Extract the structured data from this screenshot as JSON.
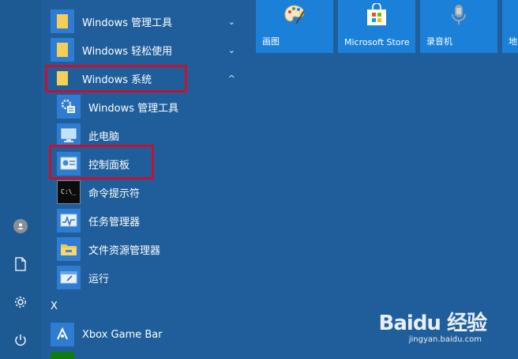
{
  "app_list": {
    "folders": [
      {
        "label": "Windows 管理工具",
        "chevron": "⌄"
      },
      {
        "label": "Windows 轻松使用",
        "chevron": "⌄"
      },
      {
        "label": "Windows 系统",
        "chevron": "^"
      }
    ],
    "sub_items": [
      {
        "label": "Windows 管理工具",
        "icon": "admin-tools-icon"
      },
      {
        "label": "此电脑",
        "icon": "this-pc-icon"
      },
      {
        "label": "控制面板",
        "icon": "control-panel-icon"
      },
      {
        "label": "命令提示符",
        "icon": "cmd-icon"
      },
      {
        "label": "任务管理器",
        "icon": "task-manager-icon"
      },
      {
        "label": "文件资源管理器",
        "icon": "file-explorer-icon"
      },
      {
        "label": "运行",
        "icon": "run-icon"
      }
    ],
    "section_letter": "X",
    "xbox": {
      "label": "Xbox Game Bar",
      "icon": "xbox-icon"
    }
  },
  "tiles": [
    {
      "label": "画图",
      "icon": "paint-icon"
    },
    {
      "label": "Microsoft Store",
      "icon": "store-icon"
    },
    {
      "label": "录音机",
      "icon": "microphone-icon"
    },
    {
      "label": "地",
      "icon": "maps-icon"
    }
  ],
  "rail": [
    {
      "icon": "user-icon"
    },
    {
      "icon": "document-icon"
    },
    {
      "icon": "settings-icon"
    },
    {
      "icon": "power-icon"
    }
  ],
  "watermark": {
    "brand": "Baidu 经验",
    "url": "jingyan.baidu.com"
  },
  "colors": {
    "background": "#1f5e9a",
    "tile": "#1b80d8",
    "highlight": "#c8102e",
    "icon_tile": "#2f7cd3"
  }
}
